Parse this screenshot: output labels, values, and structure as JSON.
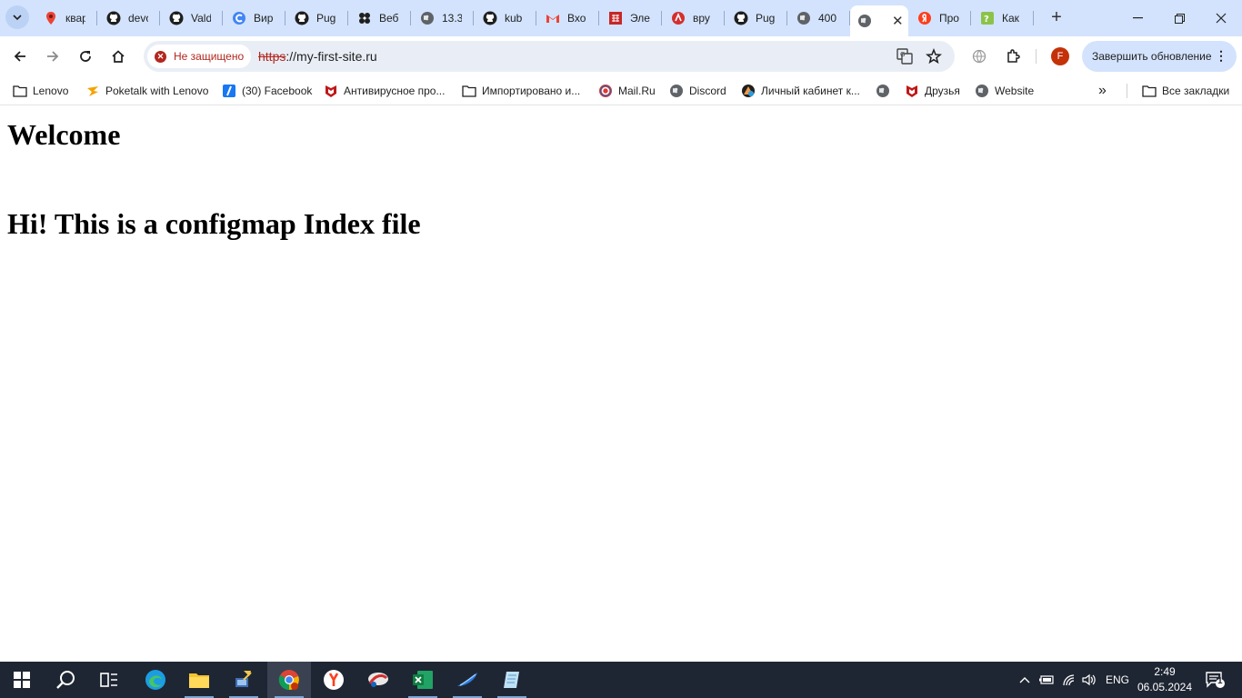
{
  "browser": {
    "tabs": [
      {
        "title": "квар",
        "icon": "map-pin-icon",
        "color": "#ea4335"
      },
      {
        "title": "devo",
        "icon": "github-icon",
        "color": "#1f1f1f"
      },
      {
        "title": "Vald",
        "icon": "github-icon",
        "color": "#1f1f1f"
      },
      {
        "title": "Вир",
        "icon": "c-logo-icon",
        "color": "#4285f4"
      },
      {
        "title": "Pug",
        "icon": "github-icon",
        "color": "#1f1f1f"
      },
      {
        "title": "Веб",
        "icon": "dots-logo-icon",
        "color": "#1f1f1f"
      },
      {
        "title": "13.3",
        "icon": "globe-icon",
        "color": "#5f6368"
      },
      {
        "title": "kub",
        "icon": "github-icon",
        "color": "#1f1f1f"
      },
      {
        "title": "Вхо",
        "icon": "gmail-icon",
        "color": "#ea4335"
      },
      {
        "title": "Эле",
        "icon": "grid-logo-icon",
        "color": "#c62828"
      },
      {
        "title": "вру",
        "icon": "red-circle-icon",
        "color": "#d32f2f"
      },
      {
        "title": "Pug",
        "icon": "github-icon",
        "color": "#1f1f1f"
      },
      {
        "title": "400",
        "icon": "globe-icon",
        "color": "#5f6368"
      }
    ],
    "active_tab": {
      "icon": "globe-icon",
      "close": "✕"
    },
    "tabs_after": [
      {
        "title": "Про",
        "icon": "yandex-icon",
        "color": "#fc3f1d"
      },
      {
        "title": "Как",
        "icon": "question-logo-icon",
        "color": "#8bc34a"
      }
    ],
    "new_tab": "+",
    "window_controls": {
      "minimize": "—",
      "maximize": "❐",
      "close": "✕"
    },
    "address": {
      "security_label": "Не защищено",
      "url_scheme": "https",
      "url_rest": "://my-first-site.ru"
    },
    "profile_initial": "F",
    "update_button": "Завершить обновление",
    "bookmarks": [
      {
        "label": "Lenovo",
        "icon": "folder-icon"
      },
      {
        "label": "Poketalk with Lenovo",
        "icon": "poketalk-icon"
      },
      {
        "label": "(30) Facebook",
        "icon": "facebook-icon"
      },
      {
        "label": "Антивирусное про...",
        "icon": "mcafee-icon"
      },
      {
        "label": "Импортировано и...",
        "icon": "folder-icon"
      },
      {
        "label": "Mail.Ru",
        "icon": "mailru-icon"
      },
      {
        "label": "Discord",
        "icon": "globe-icon"
      },
      {
        "label": "Личный кабинет к...",
        "icon": "cabinet-icon"
      },
      {
        "label": "",
        "icon": "globe-icon"
      },
      {
        "label": "Друзья",
        "icon": "mcafee-icon"
      },
      {
        "label": "Website",
        "icon": "globe-icon"
      }
    ],
    "bookmarks_more": "»",
    "all_bookmarks": "Все закладки"
  },
  "page": {
    "heading1": "Welcome",
    "heading2": "Hi! This is a configmap Index file"
  },
  "taskbar": {
    "language": "ENG",
    "time": "2:49",
    "date": "06.05.2024",
    "notification_count": "1"
  }
}
